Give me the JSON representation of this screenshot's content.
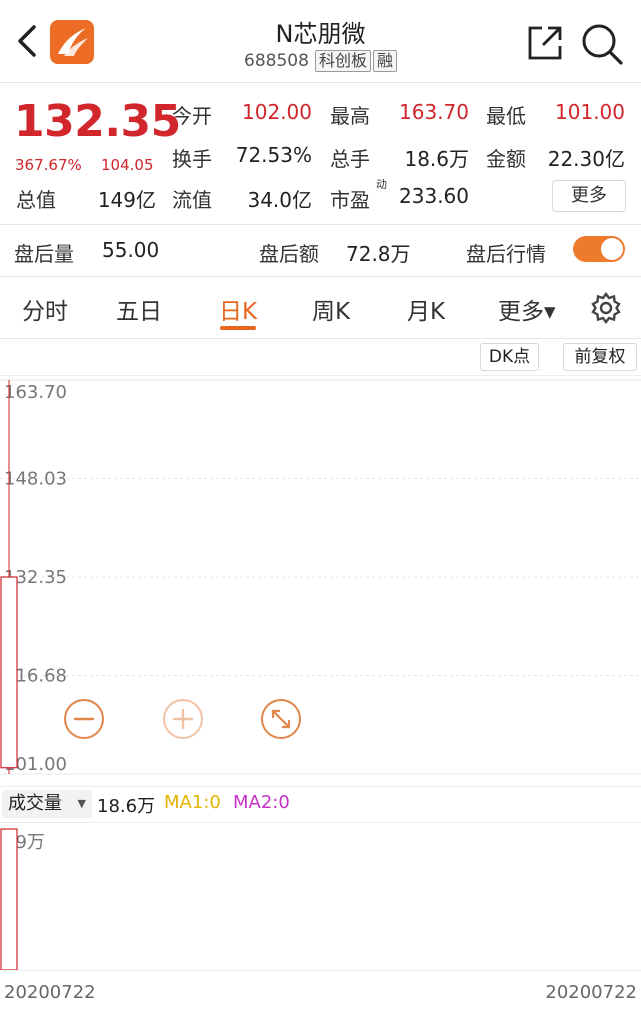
{
  "header": {
    "title": "N芯朋微",
    "code": "688508",
    "tags": [
      "科创板",
      "融"
    ]
  },
  "quote": {
    "price": "132.35",
    "change_pct": "367.67%",
    "change_amt": "104.05",
    "fields": [
      {
        "label": "今开",
        "value": "102.00"
      },
      {
        "label": "最高",
        "value": "163.70"
      },
      {
        "label": "最低",
        "value": "101.00"
      },
      {
        "label": "换手",
        "value": "72.53%"
      },
      {
        "label": "总手",
        "value": "18.6万"
      },
      {
        "label": "金额",
        "value": "22.30亿"
      },
      {
        "label": "总值",
        "value": "149亿"
      },
      {
        "label": "流值",
        "value": "34.0亿"
      },
      {
        "label": "市盈",
        "value": "233.60",
        "sup": "动"
      }
    ],
    "more_label": "更多"
  },
  "after_hours": {
    "volume_label": "盘后量",
    "volume": "55.00",
    "amount_label": "盘后额",
    "amount": "72.8万",
    "quote_label": "盘后行情",
    "toggle_on": true
  },
  "tabs": [
    {
      "label": "分时"
    },
    {
      "label": "五日"
    },
    {
      "label": "日K",
      "active": true
    },
    {
      "label": "周K"
    },
    {
      "label": "月K"
    },
    {
      "label": "更多▾"
    }
  ],
  "chart_buttons": {
    "dk": "DK点",
    "adjust": "前复权"
  },
  "chart_data": {
    "type": "candlestick",
    "y_ticks": [
      "163.70",
      "148.03",
      "132.35",
      "116.68",
      "101.00"
    ],
    "ylim": [
      101.0,
      163.7
    ],
    "candles": [
      {
        "date": "20200722",
        "open": 102.0,
        "high": 163.7,
        "low": 101.0,
        "close": 132.35
      }
    ]
  },
  "volume": {
    "selector": "成交量",
    "value": "18.6万",
    "ma1": "MA1:0",
    "ma2": "MA2:0",
    "y_max_label": "19万",
    "bar_value": 18.6,
    "y_max": 19
  },
  "dates": {
    "start": "20200722",
    "end": "20200722"
  },
  "colors": {
    "up": "#d0262c",
    "accent": "#e8651f",
    "ma1": "#e3b400",
    "ma2": "#c732c7"
  }
}
